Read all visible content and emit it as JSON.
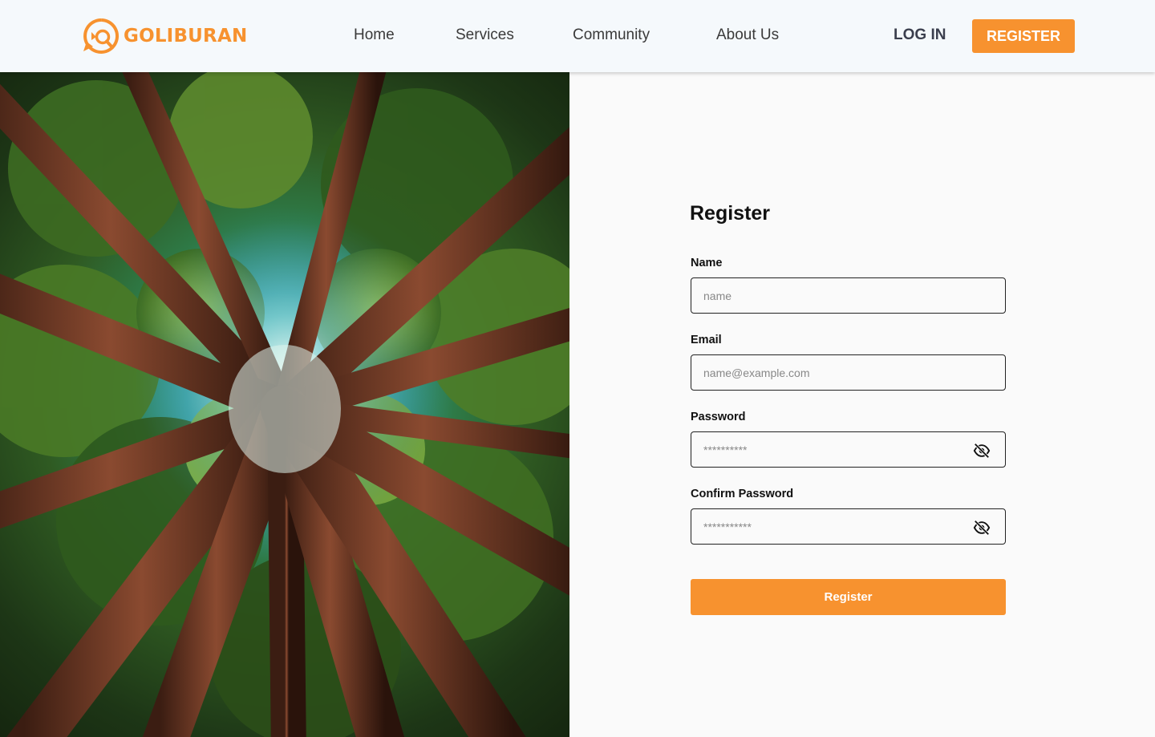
{
  "brand": {
    "name": "GOLIBURAN",
    "accent_color": "#f7922f",
    "logo_icon": "magnifier-pin-icon"
  },
  "nav": {
    "links": [
      "Home",
      "Services",
      "Community",
      "About Us"
    ],
    "login_label": "LOG IN",
    "register_label": "REGISTER"
  },
  "hero": {
    "image": "forest-canopy-looking-up"
  },
  "form": {
    "title": "Register",
    "fields": [
      {
        "label": "Name",
        "placeholder": "name",
        "value": ""
      },
      {
        "label": "Email",
        "placeholder": "name@example.com",
        "value": ""
      },
      {
        "label": "Password",
        "placeholder": "**********",
        "value": "",
        "icon": "eye-off-icon"
      },
      {
        "label": "Confirm Password",
        "placeholder": "***********",
        "value": "",
        "icon": "eye-off-icon"
      }
    ],
    "submit_label": "Register"
  }
}
